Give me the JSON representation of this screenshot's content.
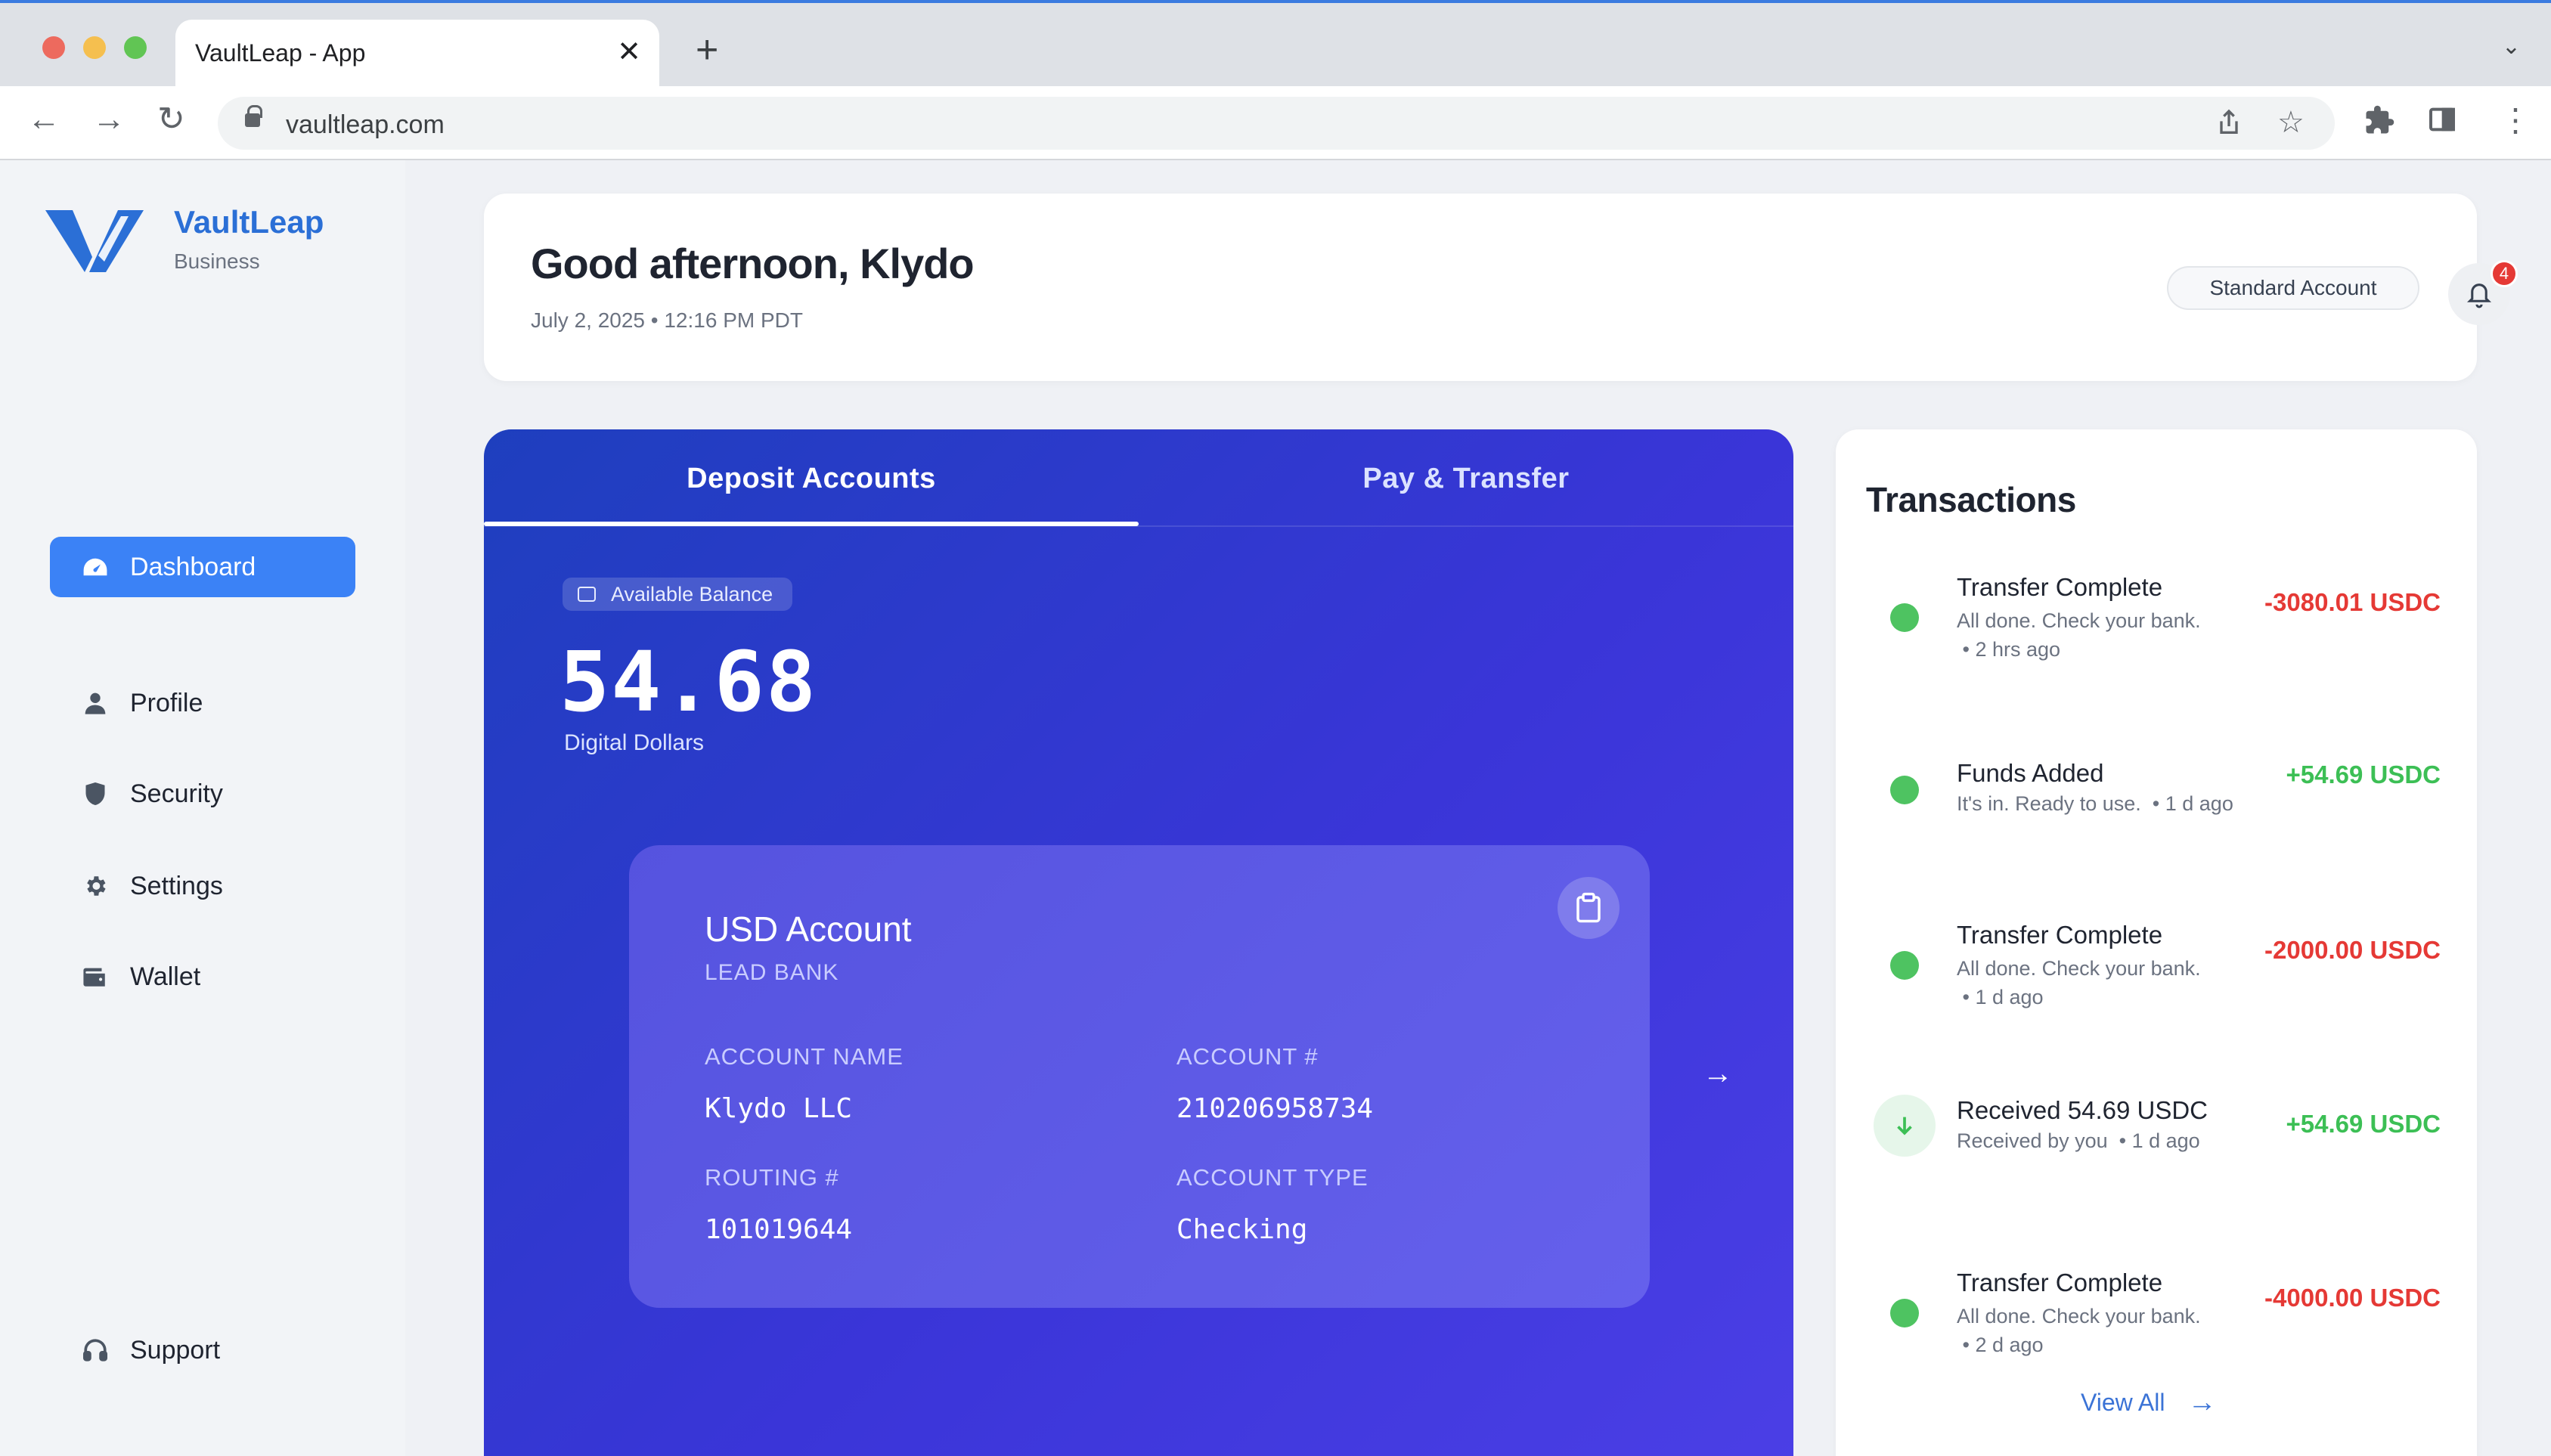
{
  "browser": {
    "tab_title": "VaultLeap - App",
    "url": "vaultleap.com"
  },
  "sidebar": {
    "brand": "VaultLeap",
    "brand_sub": "Business",
    "items": [
      {
        "label": "Dashboard",
        "icon": "dashboard-gauge-icon",
        "active": true
      },
      {
        "label": "Profile",
        "icon": "user-icon"
      },
      {
        "label": "Security",
        "icon": "shield-icon"
      },
      {
        "label": "Settings",
        "icon": "gear-icon"
      },
      {
        "label": "Wallet",
        "icon": "wallet-icon"
      }
    ],
    "support": "Support"
  },
  "header": {
    "greeting": "Good afternoon, Klydo",
    "datetime": "July 2, 2025 • 12:16 PM PDT",
    "account_type": "Standard Account",
    "notification_count": "4"
  },
  "accounts": {
    "tabs": [
      "Deposit Accounts",
      "Pay & Transfer"
    ],
    "balance_label": "Available Balance",
    "balance_value": "54.68",
    "balance_unit": "Digital Dollars",
    "card": {
      "title": "USD Account",
      "bank": "LEAD BANK",
      "account_name_label": "ACCOUNT NAME",
      "account_name": "Klydo LLC",
      "account_number_label": "ACCOUNT #",
      "account_number": "210206958734",
      "routing_label": "ROUTING #",
      "routing": "101019644",
      "account_type_label": "ACCOUNT TYPE",
      "account_type": "Checking"
    }
  },
  "transactions": {
    "heading": "Transactions",
    "items": [
      {
        "title": "Transfer Complete",
        "desc": "All done. Check your bank.",
        "time": "2 hrs ago",
        "amount": "-3080.01 USDC",
        "kind": "debit"
      },
      {
        "title": "Funds Added",
        "desc": "It's in. Ready to use.",
        "time": "1 d ago",
        "amount": "+54.69 USDC",
        "kind": "credit"
      },
      {
        "title": "Transfer Complete",
        "desc": "All done. Check your bank.",
        "time": "1 d ago",
        "amount": "-2000.00 USDC",
        "kind": "debit"
      },
      {
        "title": "Received 54.69 USDC",
        "desc": "Received by you",
        "time": "1 d ago",
        "amount": "+54.69 USDC",
        "kind": "received"
      },
      {
        "title": "Transfer Complete",
        "desc": "All done. Check your bank.",
        "time": "2 d ago",
        "amount": "-4000.00 USDC",
        "kind": "debit"
      }
    ],
    "view_all": "View All"
  },
  "colors": {
    "accent": "#3b82f6",
    "panel_gradient_start": "#1e3fbe",
    "panel_gradient_end": "#4b3fe6",
    "positive": "#3cbf55",
    "negative": "#e53935"
  }
}
